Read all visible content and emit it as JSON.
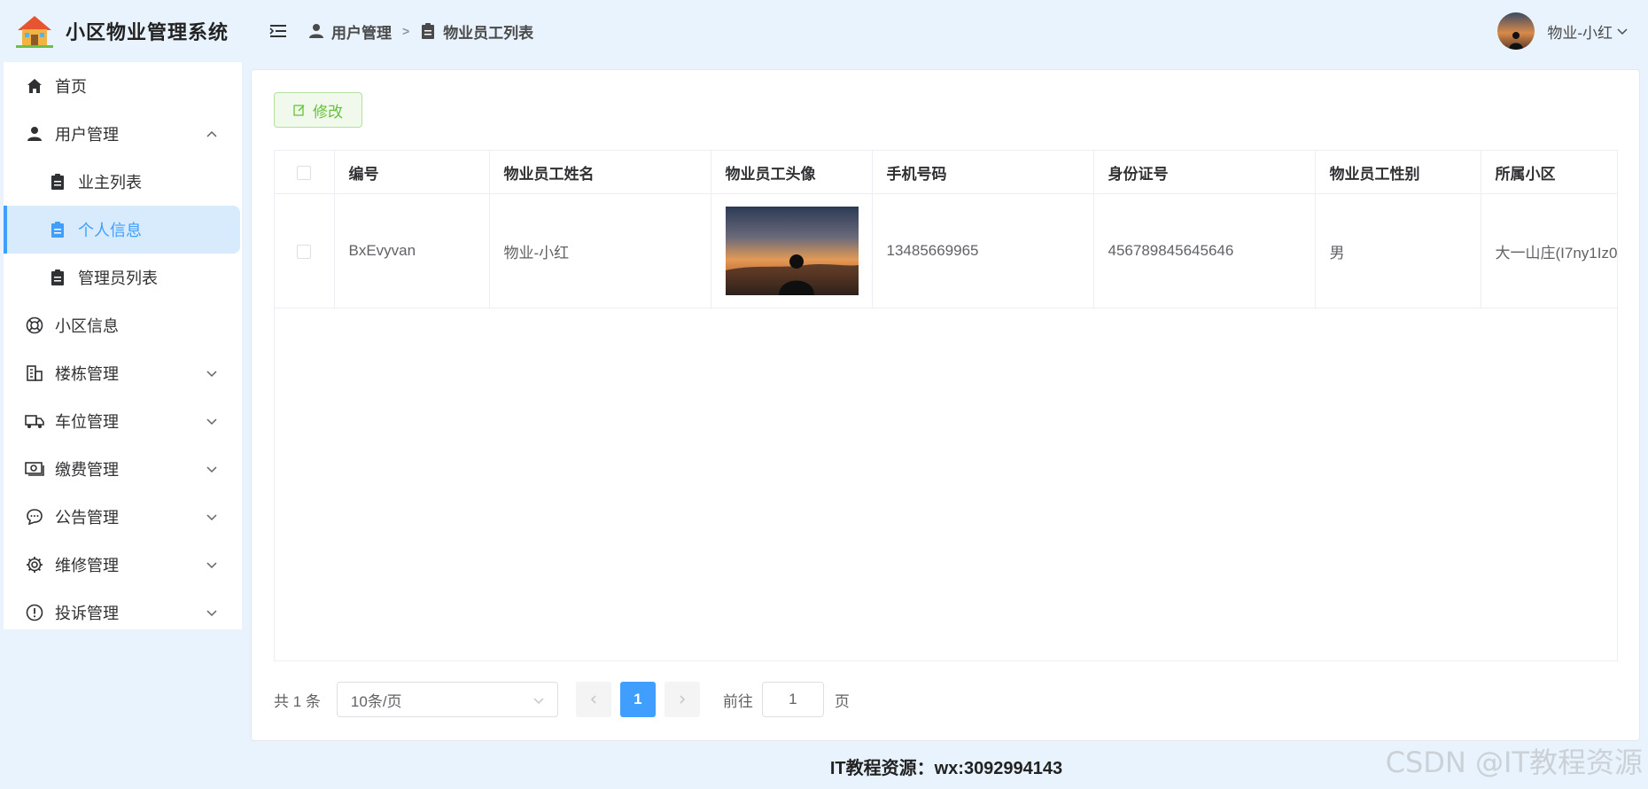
{
  "app": {
    "title": "小区物业管理系统"
  },
  "sidebar": {
    "items": [
      {
        "label": "首页",
        "icon": "home-icon"
      },
      {
        "label": "用户管理",
        "icon": "user-icon"
      },
      {
        "label": "业主列表",
        "icon": "clipboard-icon"
      },
      {
        "label": "个人信息",
        "icon": "clipboard-icon"
      },
      {
        "label": "管理员列表",
        "icon": "clipboard-icon"
      },
      {
        "label": "小区信息",
        "icon": "lifebuoy-icon"
      },
      {
        "label": "楼栋管理",
        "icon": "building-icon"
      },
      {
        "label": "车位管理",
        "icon": "truck-icon"
      },
      {
        "label": "缴费管理",
        "icon": "money-icon"
      },
      {
        "label": "公告管理",
        "icon": "chat-icon"
      },
      {
        "label": "维修管理",
        "icon": "gear-icon"
      },
      {
        "label": "投诉管理",
        "icon": "warning-icon"
      }
    ]
  },
  "header": {
    "breadcrumb": [
      "用户管理",
      "物业员工列表"
    ],
    "user_name": "物业-小红"
  },
  "toolbar": {
    "edit_label": "修改"
  },
  "table": {
    "columns": [
      "编号",
      "物业员工姓名",
      "物业员工头像",
      "手机号码",
      "身份证号",
      "物业员工性别",
      "所属小区"
    ],
    "rows": [
      {
        "id": "BxEvyvan",
        "name": "物业-小红",
        "phone": "13485669965",
        "id_card": "456789845645646",
        "gender": "男",
        "community": "大一山庄(I7ny1Iz0"
      }
    ]
  },
  "pagination": {
    "total": "共 1 条",
    "page_size": "10条/页",
    "current": "1",
    "goto_label": "前往",
    "goto_value": "1",
    "page_suffix": "页"
  },
  "footer": {
    "text": "IT教程资源：wx:3092994143"
  },
  "watermark": "CSDN @IT教程资源",
  "colors": {
    "accent": "#409eff",
    "success": "#67c23a",
    "bg": "#e8f3fd"
  }
}
